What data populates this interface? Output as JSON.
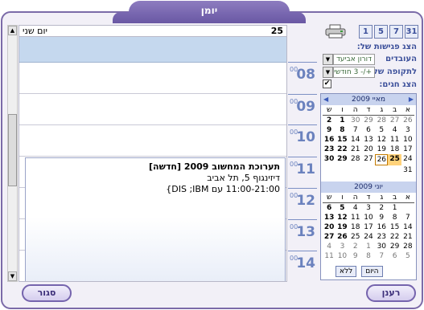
{
  "window": {
    "title": "יומן"
  },
  "day_view": {
    "day_number": "25",
    "day_name": "יום שני",
    "times": [
      "08",
      "09",
      "10",
      "11",
      "12",
      "13",
      "14"
    ],
    "minutes": "00",
    "event": {
      "title": "תערוכת המחשוב 2009 [חדשה]",
      "location": "דיזינגוף 5, תל אביב",
      "details": "11:00-21:00 עם DIS ;IBM}"
    }
  },
  "toolbar": {
    "view_buttons": [
      "31",
      "7",
      "5",
      "1"
    ],
    "printer_icon": "printer-icon"
  },
  "options": {
    "show_meetings_label": "הצג פגישות של:",
    "employees_label": "העובדים",
    "employee_value": "דורון אביעד",
    "period_label": "לתקופה של:",
    "period_value": "+/- 3 חודשי",
    "show_holidays_label": "הצג חגים:",
    "show_holidays_checked": "✔"
  },
  "mini_calendar": {
    "month1_title": "מאיי 2009",
    "dow": [
      "א",
      "ב",
      "ג",
      "ד",
      "ה",
      "ו",
      "ש"
    ],
    "month1_days": [
      [
        "26",
        "27",
        "28",
        "29",
        "30",
        "1",
        "2"
      ],
      [
        "3",
        "4",
        "5",
        "6",
        "7",
        "8",
        "9"
      ],
      [
        "10",
        "11",
        "12",
        "13",
        "14",
        "15",
        "16"
      ],
      [
        "17",
        "18",
        "19",
        "20",
        "21",
        "22",
        "23"
      ],
      [
        "24",
        "25",
        "26",
        "27",
        "28",
        "29",
        "30"
      ],
      [
        "31",
        "",
        "",
        "",
        "",
        "",
        ""
      ]
    ],
    "month2_title": "יוני 2009",
    "month2_days": [
      [
        "",
        "1",
        "2",
        "3",
        "4",
        "5",
        "6"
      ],
      [
        "7",
        "8",
        "9",
        "10",
        "11",
        "12",
        "13"
      ],
      [
        "14",
        "15",
        "16",
        "17",
        "18",
        "19",
        "20"
      ],
      [
        "21",
        "22",
        "23",
        "24",
        "25",
        "26",
        "27"
      ],
      [
        "28",
        "29",
        "30",
        "1",
        "2",
        "3",
        "4"
      ],
      [
        "5",
        "6",
        "7",
        "8",
        "9",
        "10",
        "11"
      ]
    ],
    "today_button": "היום",
    "none_button": "ללא"
  },
  "footer": {
    "close_button": "סגור",
    "refresh_button": "רענן"
  }
}
